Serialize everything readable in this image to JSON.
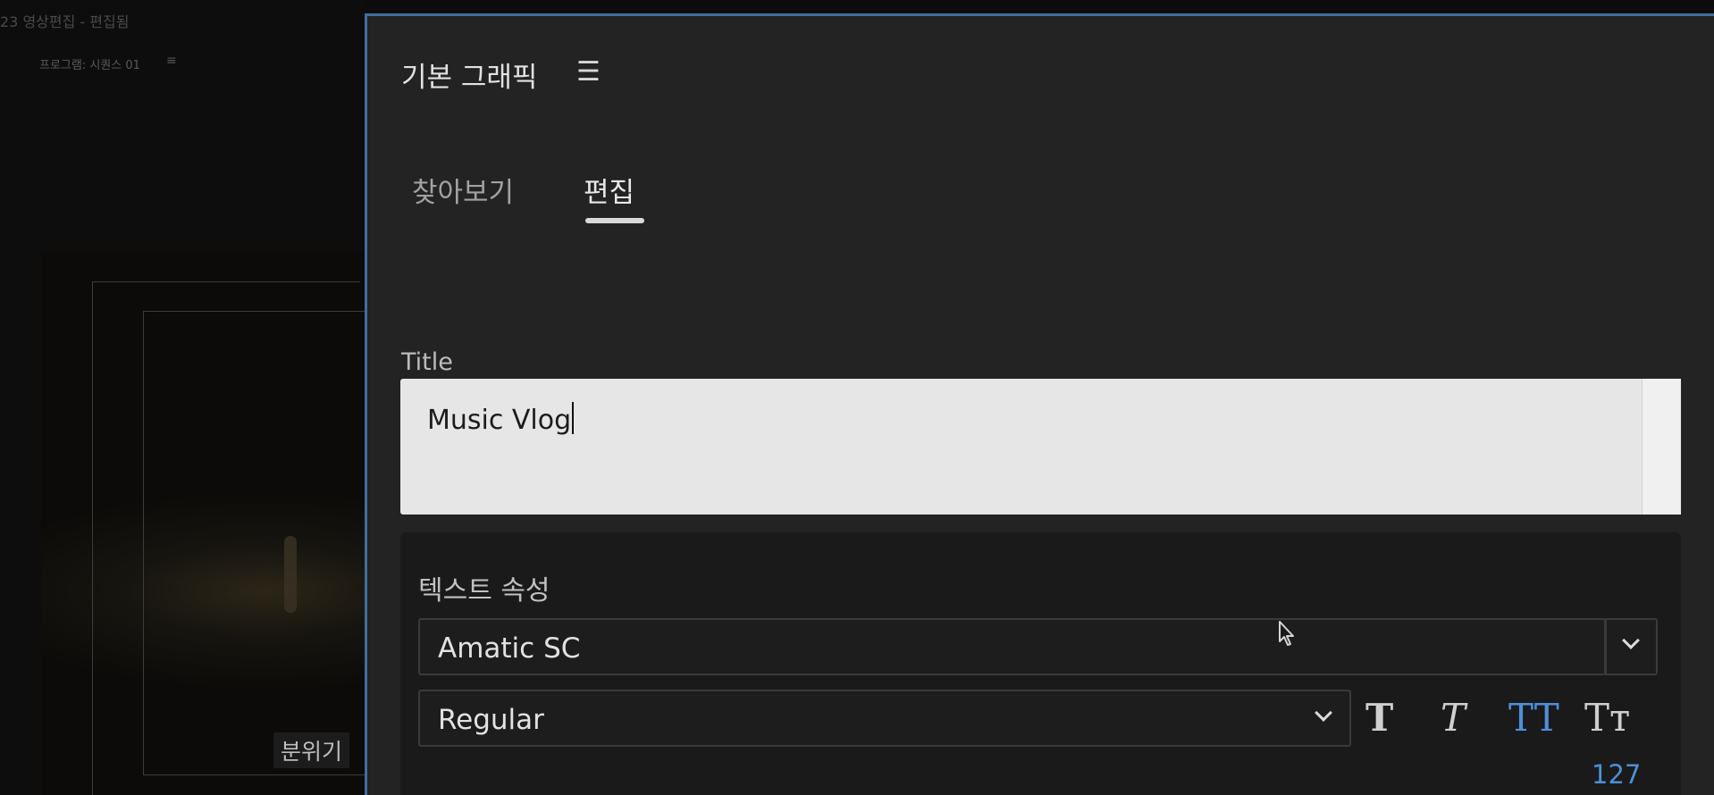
{
  "background": {
    "window_title": "23 영상편집 - 편집됨",
    "panel_label": "프로그램: 시퀀스 01",
    "panel_menu_icon": "≡",
    "caption_text": "분위기"
  },
  "panel": {
    "title": "기본 그래픽",
    "menu_icon": "☰",
    "tabs": [
      {
        "label": "찾아보기",
        "active": false
      },
      {
        "label": "편집",
        "active": true
      }
    ]
  },
  "title_field": {
    "label": "Title",
    "value": "Music Vlog"
  },
  "text_properties": {
    "section_title": "텍스트 속성",
    "font_family": "Amatic SC",
    "font_style": "Regular",
    "style_buttons": [
      {
        "name": "faux-bold",
        "glyph": "T",
        "active": false
      },
      {
        "name": "faux-italic",
        "glyph": "T",
        "active": false
      },
      {
        "name": "all-caps",
        "glyph": "TT",
        "active": true
      },
      {
        "name": "small-caps",
        "glyph": "Tт",
        "active": false
      }
    ],
    "value_readout": "127"
  },
  "colors": {
    "accent": "#4d8fd9",
    "panel_bg": "#232323",
    "focus_border": "#3f6ea0"
  }
}
